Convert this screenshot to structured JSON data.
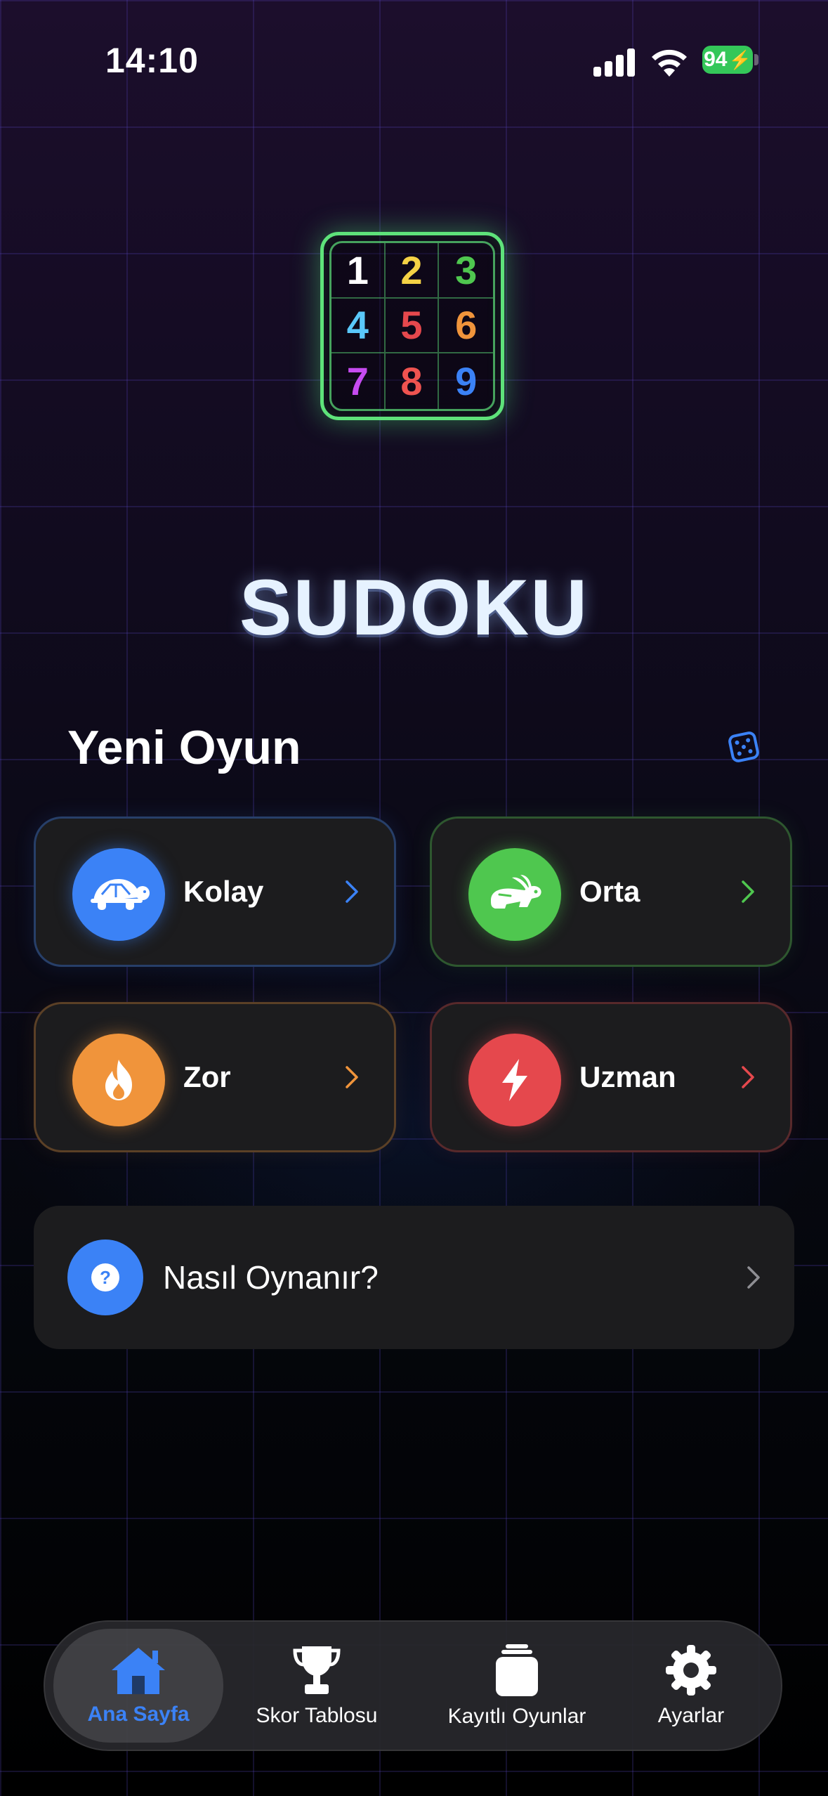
{
  "status_bar": {
    "time": "14:10",
    "battery": "94",
    "icons": [
      "signal-icon",
      "wifi-icon",
      "battery-charging-icon"
    ]
  },
  "logo": {
    "cells": [
      {
        "n": "1",
        "color": "#ffffff"
      },
      {
        "n": "2",
        "color": "#f5d245"
      },
      {
        "n": "3",
        "color": "#4fc74f"
      },
      {
        "n": "4",
        "color": "#5ac8fa"
      },
      {
        "n": "5",
        "color": "#e5484d"
      },
      {
        "n": "6",
        "color": "#f0943b"
      },
      {
        "n": "7",
        "color": "#c64bf0"
      },
      {
        "n": "8",
        "color": "#ef5350"
      },
      {
        "n": "9",
        "color": "#3b82f6"
      }
    ],
    "border_color": "#5ee27a"
  },
  "title": "SUDOKU",
  "new_game": {
    "heading": "Yeni Oyun",
    "icon": "dice-icon"
  },
  "difficulties": [
    {
      "label": "Kolay",
      "color": "#3b82f6",
      "icon": "turtle-icon"
    },
    {
      "label": "Orta",
      "color": "#4fc74f",
      "icon": "rabbit-icon"
    },
    {
      "label": "Zor",
      "color": "#f0943b",
      "icon": "flame-icon"
    },
    {
      "label": "Uzman",
      "color": "#e5484d",
      "icon": "bolt-icon"
    }
  ],
  "how_to": {
    "label": "Nasıl Oynanır?",
    "icon": "question-icon"
  },
  "tabbar": {
    "tabs": [
      {
        "label": "Ana Sayfa",
        "icon": "house-icon",
        "active": true
      },
      {
        "label": "Skor Tablosu",
        "icon": "trophy-icon",
        "active": false
      },
      {
        "label": "Kayıtlı Oyunlar",
        "icon": "saved-games-icon",
        "active": false
      },
      {
        "label": "Ayarlar",
        "icon": "gear-icon",
        "active": false
      }
    ],
    "accent": "#3b82f6"
  }
}
